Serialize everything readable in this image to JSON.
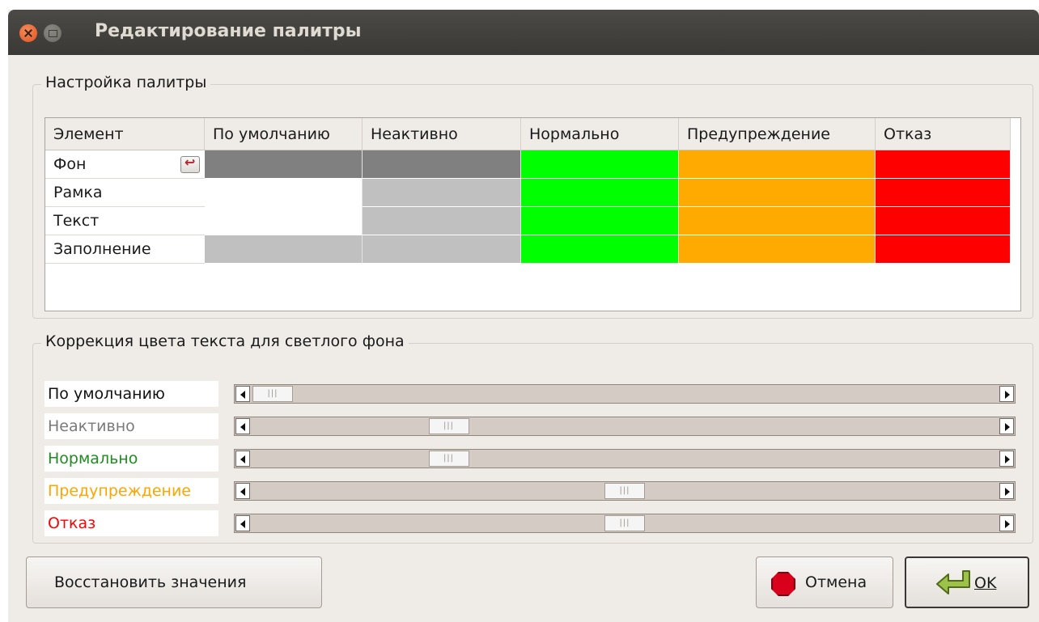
{
  "window": {
    "title": "Редактирование палитры"
  },
  "palette_group": {
    "title": "Настройка палитры",
    "columns": [
      "Элемент",
      "По умолчанию",
      "Неактивно",
      "Нормально",
      "Предупреждение",
      "Отказ"
    ],
    "rows": [
      {
        "label": "Фон",
        "cells": [
          "#808080",
          "#808080",
          "#00ff00",
          "#ffaa00",
          "#ff0000"
        ]
      },
      {
        "label": "Рамка",
        "cells": [
          "#ffffff",
          "#c0c0c0",
          "#00ff00",
          "#ffaa00",
          "#ff0000"
        ]
      },
      {
        "label": "Текст",
        "cells": [
          "#ffffff",
          "#c0c0c0",
          "#00ff00",
          "#ffaa00",
          "#ff0000"
        ]
      },
      {
        "label": "Заполнение",
        "cells": [
          "#c0c0c0",
          "#c0c0c0",
          "#00ff00",
          "#ffaa00",
          "#ff0000"
        ]
      }
    ]
  },
  "correction_group": {
    "title": "Коррекция цвета текста для светлого фона",
    "sliders": [
      {
        "label": "По умолчанию",
        "color": "#111111",
        "level": 0.0
      },
      {
        "label": "Неактивно",
        "color": "#7a7a7a",
        "level": 0.25
      },
      {
        "label": "Нормально",
        "color": "#1f8c1f",
        "level": 0.25
      },
      {
        "label": "Предупреждение",
        "color": "#ffa500",
        "level": 0.5
      },
      {
        "label": "Отказ",
        "color": "#ff0000",
        "level": 0.5
      }
    ]
  },
  "buttons": {
    "restore": "Восстановить значения",
    "cancel": "Отмена",
    "ok": "OK"
  }
}
